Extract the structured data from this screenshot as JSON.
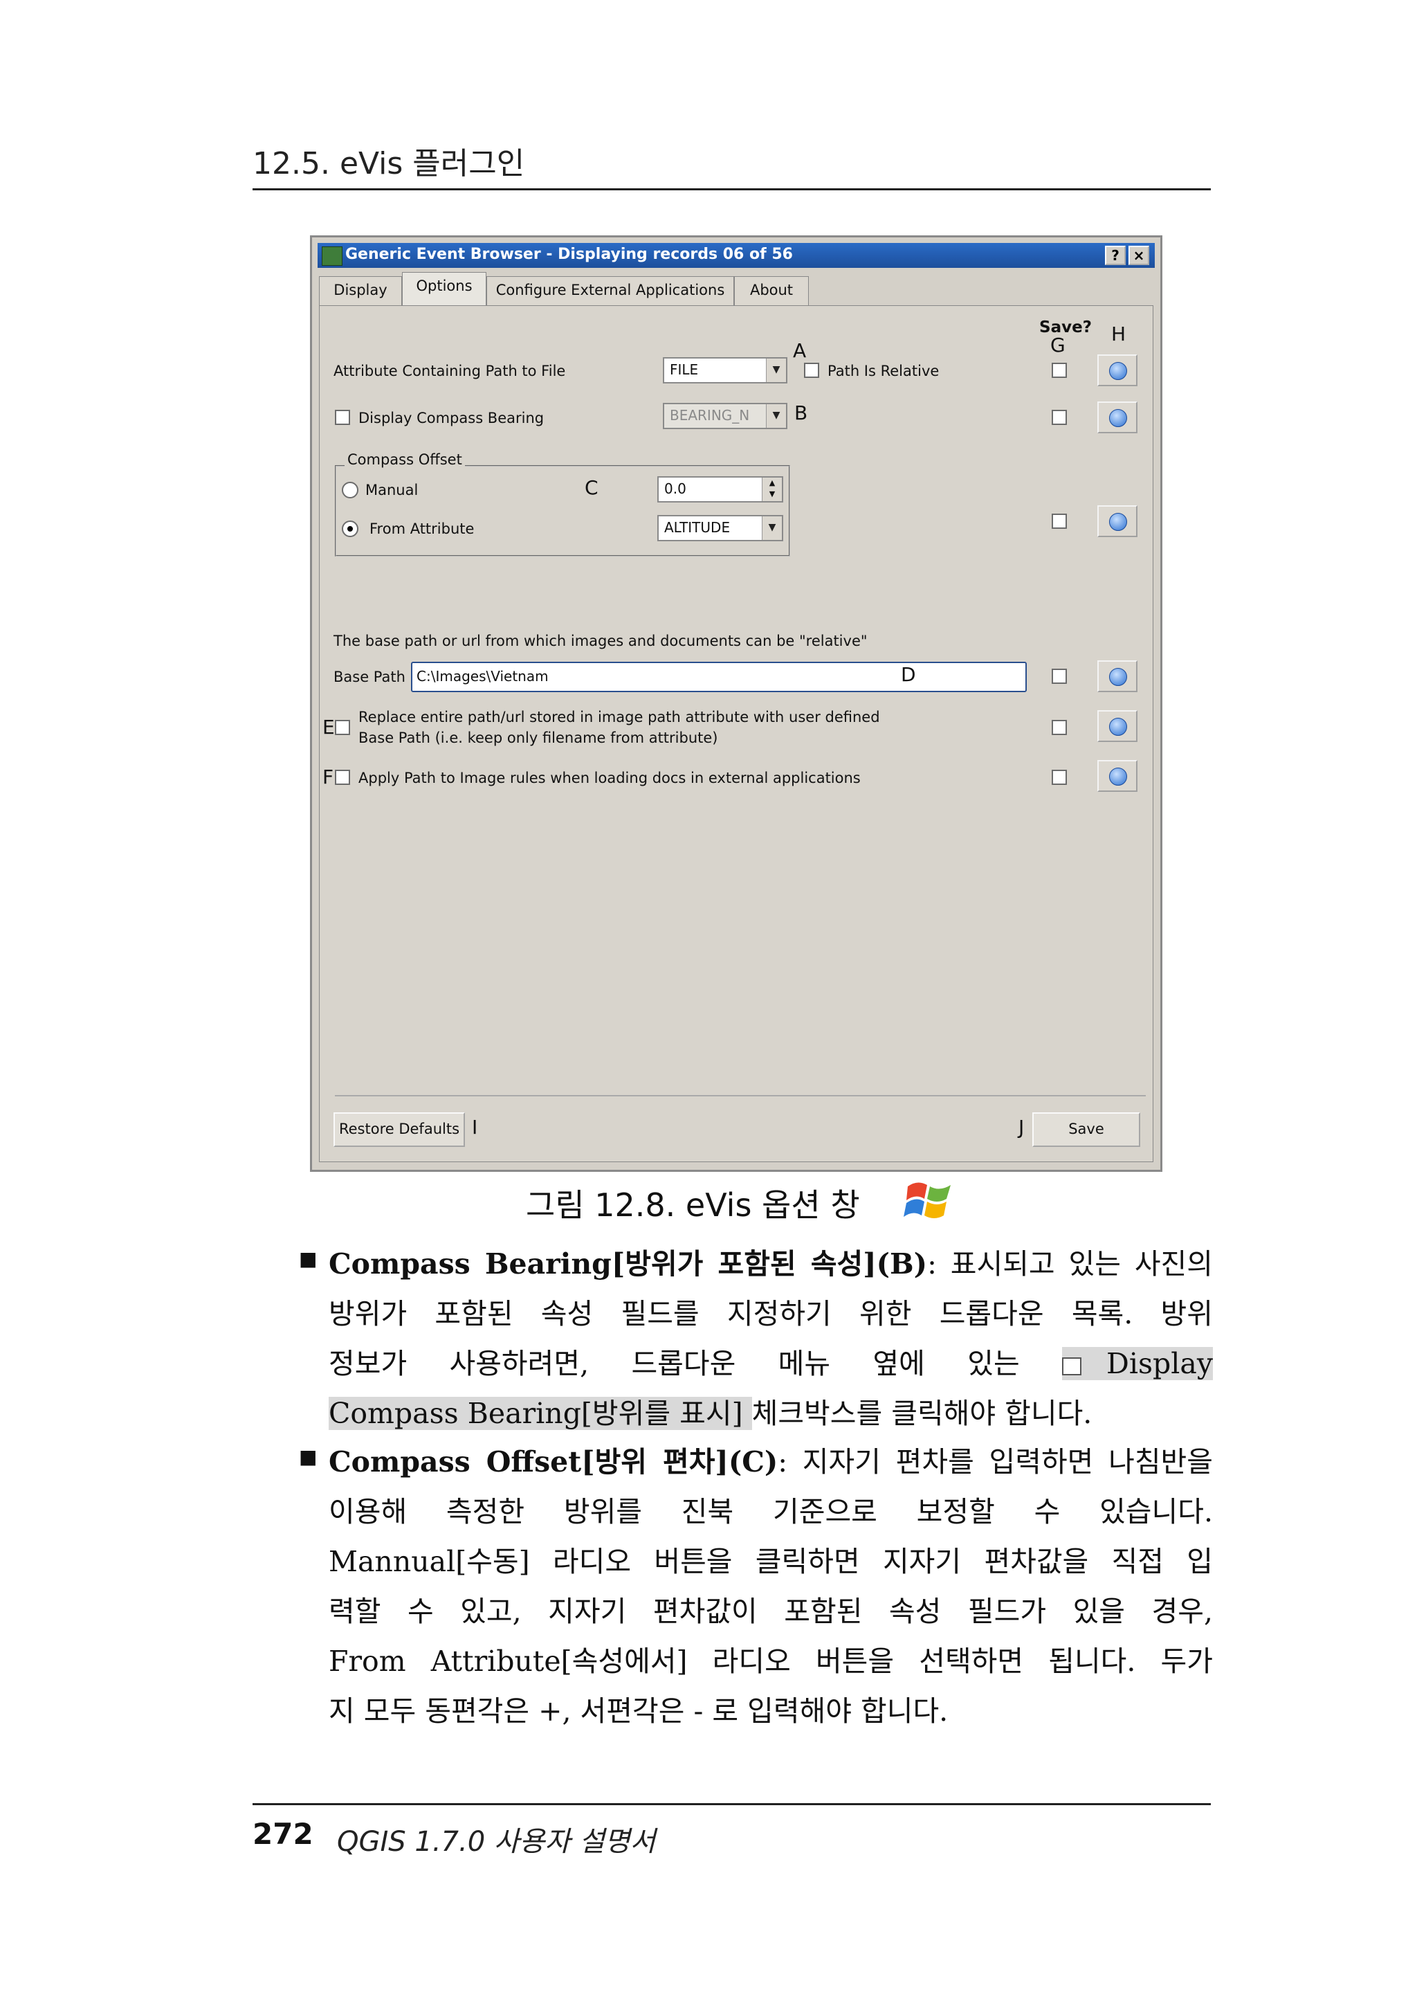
{
  "header": {
    "section": "12.5. eVis 플러그인"
  },
  "footer": {
    "page_number": "272",
    "book_title": "QGIS 1.7.0 사용자 설명서"
  },
  "window": {
    "title": "Generic Event Browser - Displaying records 06 of 56",
    "help_button": "?",
    "close_button": "×",
    "tabs": [
      "Display",
      "Options",
      "Configure External Applications",
      "About"
    ],
    "save_header": "Save?",
    "markers": {
      "A": "A",
      "B": "B",
      "C": "C",
      "D": "D",
      "E": "E",
      "F": "F",
      "G": "G",
      "H": "H",
      "I": "I",
      "J": "J"
    },
    "attribute_path_label": "Attribute Containing Path to File",
    "attribute_path_value": "FILE",
    "path_relative_label": "Path Is Relative",
    "display_compass_label": "Display Compass Bearing",
    "compass_bearing_value": "BEARING_N",
    "compass_offset_title": "Compass Offset",
    "manual_label": "Manual",
    "manual_value": "0.0",
    "from_attribute_label": "From Attribute",
    "from_attribute_value": "ALTITUDE",
    "base_path_note": "The base path or url from which images and documents can be \"relative\"",
    "base_path_label": "Base Path",
    "base_path_value": "C:\\Images\\Vietnam",
    "replace_path_line1": "Replace entire path/url stored in image path attribute with user defined",
    "replace_path_line2": "Base Path (i.e. keep only filename from attribute)",
    "apply_path_label": "Apply Path to Image rules when loading docs in external applications",
    "restore_defaults": "Restore Defaults",
    "save": "Save"
  },
  "caption": "그림 12.8. eVis 옵션 창",
  "bullets": [
    {
      "lines": [
        {
          "parts": [
            {
              "t": "Compass Bearing[방위가 포함된 속성](B)",
              "b": true
            },
            {
              "t": ": 표시되고 있는 사진의"
            }
          ]
        },
        {
          "parts": [
            {
              "t": "방위가 포함된 속성 필드를 지정하기 위한 드롭다운 목록. 방위"
            }
          ]
        },
        {
          "parts": [
            {
              "t": "정보가 사용하려면, 드롭다운 메뉴 옆에 있는 "
            },
            {
              "t": "Display",
              "hl": true,
              "cb": true
            }
          ]
        },
        {
          "parts": [
            {
              "t": "Compass Bearing[방위를 표시] ",
              "hl": true
            },
            {
              "t": "체크박스를 클릭해야 합니다."
            }
          ],
          "last": true
        }
      ]
    },
    {
      "lines": [
        {
          "parts": [
            {
              "t": "Compass Offset[방위 편차](C)",
              "b": true
            },
            {
              "t": ": 지자기 편차를 입력하면 나침반을"
            }
          ]
        },
        {
          "parts": [
            {
              "t": "이용해 측정한 방위를 진북 기준으로 보정할 수 있습니다."
            }
          ]
        },
        {
          "parts": [
            {
              "t": "Mannual[수동] 라디오 버튼을 클릭하면 지자기 편차값을 직접 입"
            }
          ]
        },
        {
          "parts": [
            {
              "t": "력할 수 있고, 지자기 편차값이 포함된 속성 필드가 있을 경우,"
            }
          ]
        },
        {
          "parts": [
            {
              "t": "From Attribute[속성에서] 라디오 버튼을 선택하면 됩니다. 두가"
            }
          ]
        },
        {
          "parts": [
            {
              "t": "지 모두 동편각은 +, 서편각은 - 로 입력해야 합니다."
            }
          ],
          "last": true
        }
      ]
    }
  ]
}
